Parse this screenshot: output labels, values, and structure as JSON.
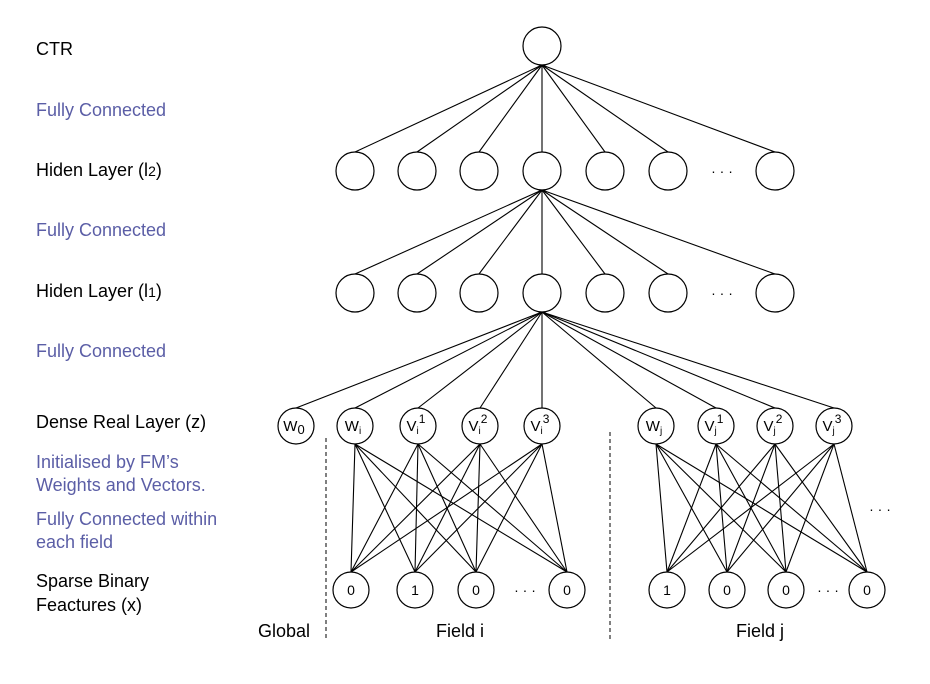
{
  "labels": {
    "ctr": "CTR",
    "fc1": "Fully Connected",
    "hidden2": "Hiden Layer (l",
    "hidden2_sub": "2",
    "hidden2_close": ")",
    "fc2": "Fully Connected",
    "hidden1": "Hiden Layer (l",
    "hidden1_sub": "1",
    "hidden1_close": ")",
    "fc3": "Fully Connected",
    "dense": "Dense Real Layer (z)",
    "init_line1": "Initialised by FM’s",
    "init_line2": "Weights and Vectors.",
    "fcwithin_line1": "Fully Connected within",
    "fcwithin_line2": "each field",
    "sparse_line1": "Sparse Binary",
    "sparse_line2": "Feactures (x)"
  },
  "sections": {
    "global": "Global",
    "field_i": "Field i",
    "field_j": "Field j"
  },
  "ellipsis": "· · ·",
  "colors": {
    "text_primary": "#000000",
    "text_annotation": "#5b5ea6",
    "stroke": "#000000"
  },
  "network": {
    "output_layer": {
      "name": "CTR",
      "nodes": 1
    },
    "hidden_layer_2": {
      "nodes_shown": 7,
      "has_ellipsis": true
    },
    "hidden_layer_1": {
      "nodes_shown": 7,
      "has_ellipsis": true
    },
    "dense_layer": {
      "global_nodes": [
        {
          "base": "W",
          "sub": "0",
          "sup": ""
        }
      ],
      "field_i_nodes": [
        {
          "base": "W",
          "sub": "i",
          "sup": ""
        },
        {
          "base": "V",
          "sub": "i",
          "sup": "1"
        },
        {
          "base": "V",
          "sub": "i",
          "sup": "2"
        },
        {
          "base": "V",
          "sub": "i",
          "sup": "3"
        }
      ],
      "field_j_nodes": [
        {
          "base": "W",
          "sub": "j",
          "sup": ""
        },
        {
          "base": "V",
          "sub": "j",
          "sup": "1"
        },
        {
          "base": "V",
          "sub": "j",
          "sup": "2"
        },
        {
          "base": "V",
          "sub": "j",
          "sup": "3"
        }
      ]
    },
    "sparse_layer": {
      "field_i_values": [
        "0",
        "1",
        "0",
        "0"
      ],
      "field_j_values": [
        "1",
        "0",
        "0",
        "0"
      ]
    }
  }
}
